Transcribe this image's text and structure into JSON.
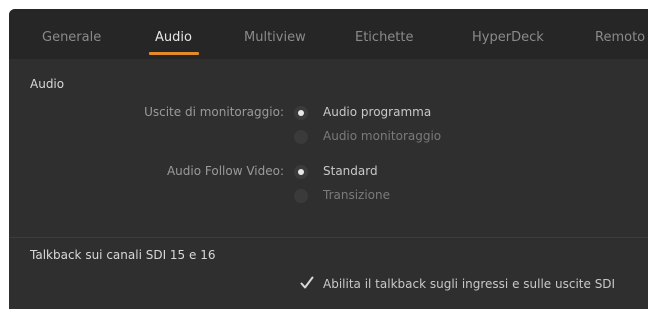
{
  "tabs": [
    {
      "label": "Generale",
      "active": false
    },
    {
      "label": "Audio",
      "active": true
    },
    {
      "label": "Multiview",
      "active": false
    },
    {
      "label": "Etichette",
      "active": false
    },
    {
      "label": "HyperDeck",
      "active": false
    },
    {
      "label": "Remoto",
      "active": false
    }
  ],
  "audio": {
    "section_title": "Audio",
    "monitor_outputs": {
      "label": "Uscite di monitoraggio:",
      "options": [
        {
          "label": "Audio programma",
          "selected": true
        },
        {
          "label": "Audio monitoraggio",
          "selected": false
        }
      ]
    },
    "follow_video": {
      "label": "Audio Follow Video:",
      "options": [
        {
          "label": "Standard",
          "selected": true
        },
        {
          "label": "Transizione",
          "selected": false
        }
      ]
    }
  },
  "talkback": {
    "section_title": "Talkback sui canali SDI 15 e 16",
    "checkbox_label": "Abilita il talkback sugli ingressi e sulle uscite SDI",
    "checked": true
  },
  "colors": {
    "accent": "#e58a2b",
    "panel_bg": "#2f2f2f",
    "tabbar_bg": "#262626"
  }
}
